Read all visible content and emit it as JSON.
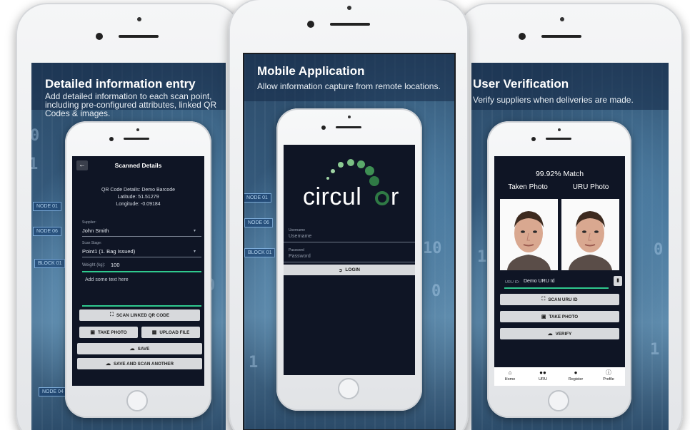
{
  "panel_left": {
    "banner_title": "Detailed information entry",
    "banner_sub_lines": [
      "Add detailed information to each scan point,",
      "including pre-configured attributes, linked QR",
      "Codes & images."
    ],
    "app": {
      "back_icon": "arrow-left-icon",
      "title": "Scanned Details",
      "qr_details": "QR Code Details: Demo Barcode",
      "latitude": "Latitude: 51.51279",
      "longitude": "Longitude: -0.09184",
      "supplier_label": "Supplier:",
      "supplier_value": "John Smith",
      "scan_stage_label": "Scan Stage:",
      "scan_stage_value": "Point1 (1. Bag Issued)",
      "weight_label": "Weight (kg):",
      "weight_value": "100",
      "textarea_placeholder": "Add some text here",
      "scan_linked_qr": "Scan linked QR code",
      "take_photo": "Take photo",
      "upload_file": "Upload file",
      "save": "Save",
      "save_and_scan": "Save and scan another"
    },
    "bg_tags": [
      "NODE 01",
      "NODE 06",
      "BLOCK 01",
      "NODE 04"
    ]
  },
  "panel_center": {
    "banner_title": "Mobile Application",
    "banner_sub": "Allow information capture from remote locations.",
    "app": {
      "logo_text_left": "circul",
      "logo_text_right": "r",
      "username_label": "Username",
      "username_placeholder": "Username",
      "password_label": "Password",
      "password_placeholder": "Password",
      "login": "LOGIN"
    },
    "brand_colors": {
      "dark_green": "#2f7a45",
      "light_green": "#9fd3a4",
      "bg": "#0f1525"
    },
    "bg_tags": [
      "NODE 01",
      "BLOCK 01",
      "NODE 06"
    ]
  },
  "panel_right": {
    "banner_title": "User Verification",
    "banner_sub": "Verify suppliers when deliveries are made.",
    "app": {
      "match": "99.92% Match",
      "taken_photo": "Taken Photo",
      "uru_photo": "URU Photo",
      "uru_id_label": "URU ID:",
      "uru_id_value": "Demo URU Id",
      "scan_uru_id": "Scan URU ID",
      "take_photo": "Take photo",
      "verify": "Verify",
      "nav": [
        {
          "label": "Home",
          "icon": "home-icon"
        },
        {
          "label": "URU",
          "icon": "group-icon"
        },
        {
          "label": "Register",
          "icon": "person-icon"
        },
        {
          "label": "Profile",
          "icon": "info-icon"
        }
      ]
    }
  }
}
